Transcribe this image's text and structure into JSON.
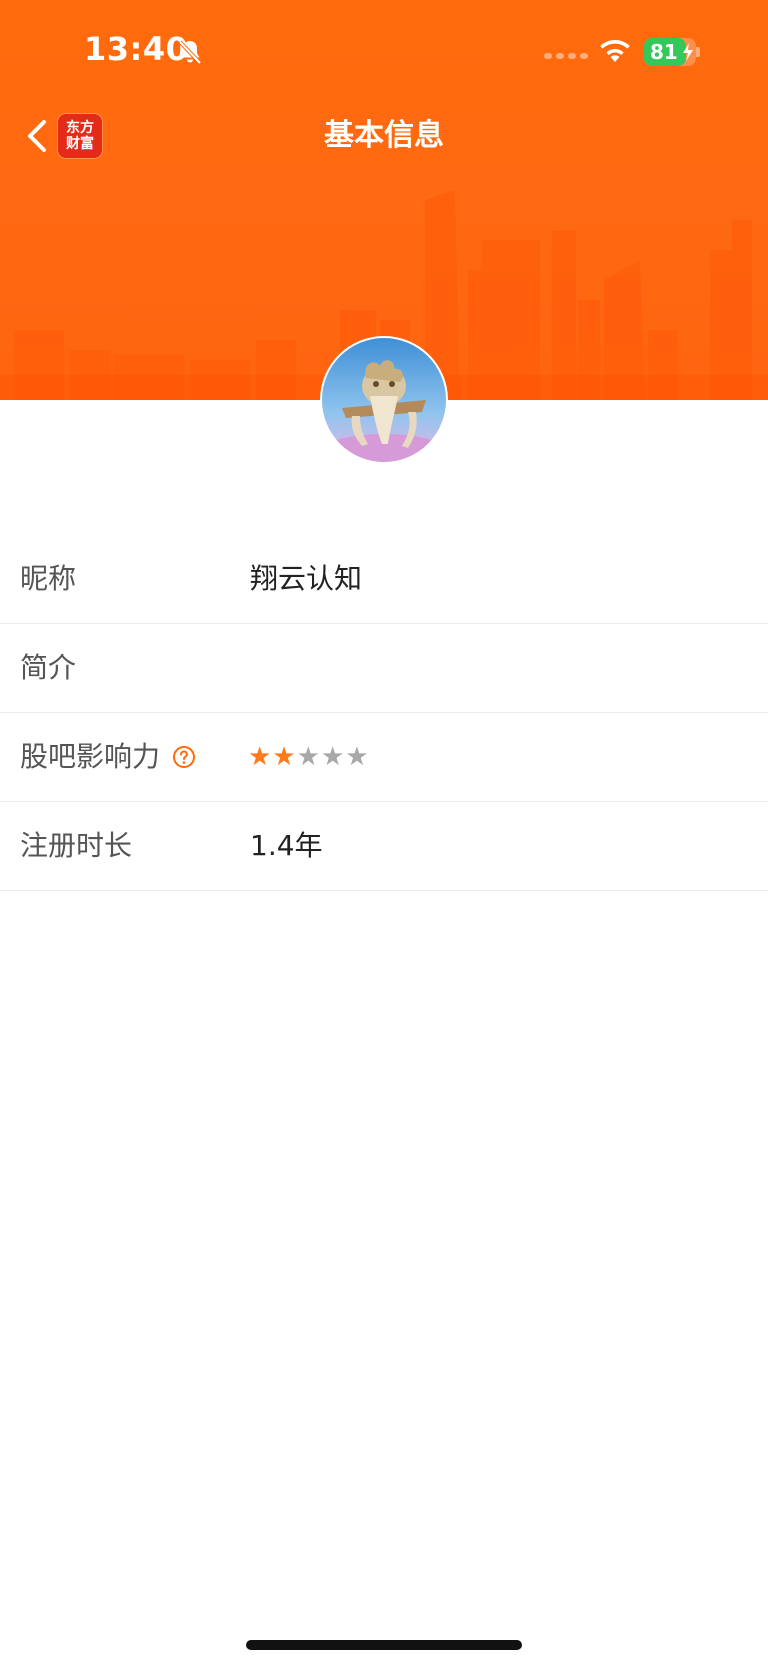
{
  "status_bar": {
    "time": "13:40",
    "battery_percent": "81",
    "battery_level": 0.81,
    "icons": [
      "bell-off-icon",
      "cellular-signal-icon",
      "wifi-icon",
      "battery-charging-icon"
    ]
  },
  "nav": {
    "title": "基本信息",
    "back_icon": "chevron-left-icon",
    "logo_line1": "东方",
    "logo_line2": "财富"
  },
  "profile": {
    "avatar_icon": "user-avatar"
  },
  "info_rows": [
    {
      "label": "昵称",
      "value": "翔云认知"
    },
    {
      "label": "简介",
      "value": ""
    },
    {
      "label": "股吧影响力",
      "help_icon": "question-circle-icon",
      "rating": 2,
      "rating_max": 5
    },
    {
      "label": "注册时长",
      "value": "1.4年"
    }
  ],
  "colors": {
    "header_orange": "#ff6a0b",
    "star_active": "#ff7a1a",
    "star_inactive": "#a8a8a8",
    "battery_green": "#34c759"
  }
}
